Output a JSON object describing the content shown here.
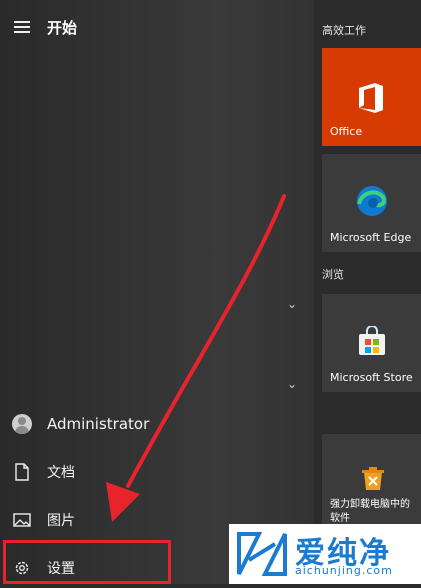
{
  "start_menu": {
    "title": "开始",
    "nav": {
      "user": "Administrator",
      "documents": "文档",
      "pictures": "图片",
      "settings": "设置"
    }
  },
  "tiles": {
    "group_productivity": "高效工作",
    "group_browse": "浏览",
    "office": "Office",
    "edge": "Microsoft Edge",
    "store": "Microsoft Store",
    "uninstall": "强力卸载电脑中的软件"
  },
  "watermark": {
    "chars": "爱纯净",
    "url": "aichunjing.com"
  },
  "colors": {
    "office_tile": "#d83b01",
    "highlight": "#e8232c",
    "arrow": "#e8232c",
    "watermark": "#1b7bd1"
  },
  "icons": [
    "hamburger-icon",
    "user-avatar-icon",
    "document-icon",
    "picture-icon",
    "gear-icon",
    "chevron-down-icon",
    "office-icon",
    "edge-icon",
    "store-icon",
    "uninstall-icon"
  ]
}
